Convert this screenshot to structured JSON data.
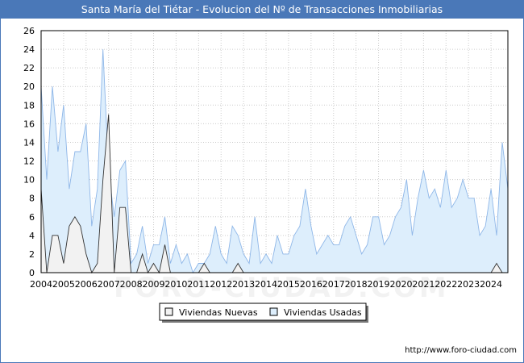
{
  "window": {
    "footer_url": "http://www.foro-ciudad.com",
    "watermark": "FORO-CIUDAD.COM"
  },
  "colors": {
    "title_bar": "#4a78b8",
    "nuevas_fill": "#f2f2f2",
    "nuevas_line": "#333333",
    "usadas_fill": "#ddeefc",
    "usadas_line": "#8fb7e8",
    "grid": "#cccccc"
  },
  "chart_data": {
    "type": "area",
    "title": "Santa María del Tiétar - Evolucion del Nº de Transacciones Inmobiliarias",
    "xlabel": "",
    "ylabel": "",
    "ylim": [
      0,
      26
    ],
    "yticks": [
      0,
      2,
      4,
      6,
      8,
      10,
      12,
      14,
      16,
      18,
      20,
      22,
      24,
      26
    ],
    "xticks": [
      "2004",
      "2005",
      "2006",
      "2007",
      "2008",
      "2009",
      "2010",
      "2011",
      "2012",
      "2013",
      "2014",
      "2015",
      "2016",
      "2017",
      "2018",
      "2019",
      "2020",
      "2021",
      "2022",
      "2023",
      "2024"
    ],
    "x_period": "quarterly, 2004 Q1 to 2024 Q4",
    "grid": true,
    "legend_position": "bottom-center",
    "series": [
      {
        "name": "Viviendas Nuevas",
        "values": [
          9,
          0,
          4,
          4,
          1,
          5,
          6,
          5,
          2,
          0,
          1,
          10,
          17,
          0,
          7,
          7,
          0,
          0,
          2,
          0,
          1,
          0,
          3,
          0,
          0,
          0,
          0,
          0,
          0,
          1,
          0,
          0,
          0,
          0,
          0,
          1,
          0,
          0,
          0,
          0,
          0,
          0,
          0,
          0,
          0,
          0,
          0,
          0,
          0,
          0,
          0,
          0,
          0,
          0,
          0,
          0,
          0,
          0,
          0,
          0,
          0,
          0,
          0,
          0,
          0,
          0,
          0,
          0,
          0,
          0,
          0,
          0,
          0,
          0,
          0,
          0,
          0,
          0,
          0,
          0,
          0,
          1,
          0,
          0,
          0,
          0,
          0,
          1,
          0,
          0,
          0,
          0,
          0,
          0,
          0,
          0,
          0,
          0,
          0,
          0,
          0
        ]
      },
      {
        "name": "Viviendas Usadas",
        "values": [
          20,
          10,
          20,
          13,
          18,
          9,
          13,
          13,
          16,
          5,
          9,
          24,
          11,
          6,
          11,
          12,
          1,
          2,
          5,
          1,
          3,
          3,
          6,
          1,
          3,
          1,
          2,
          0,
          1,
          1,
          2,
          5,
          2,
          1,
          5,
          4,
          2,
          1,
          6,
          1,
          2,
          1,
          4,
          2,
          2,
          4,
          5,
          9,
          5,
          2,
          3,
          4,
          3,
          3,
          5,
          6,
          4,
          2,
          3,
          6,
          6,
          3,
          4,
          6,
          7,
          10,
          4,
          8,
          11,
          8,
          9,
          7,
          11,
          7,
          8,
          10,
          8,
          8,
          4,
          5,
          9,
          4,
          14,
          9
        ]
      }
    ]
  }
}
